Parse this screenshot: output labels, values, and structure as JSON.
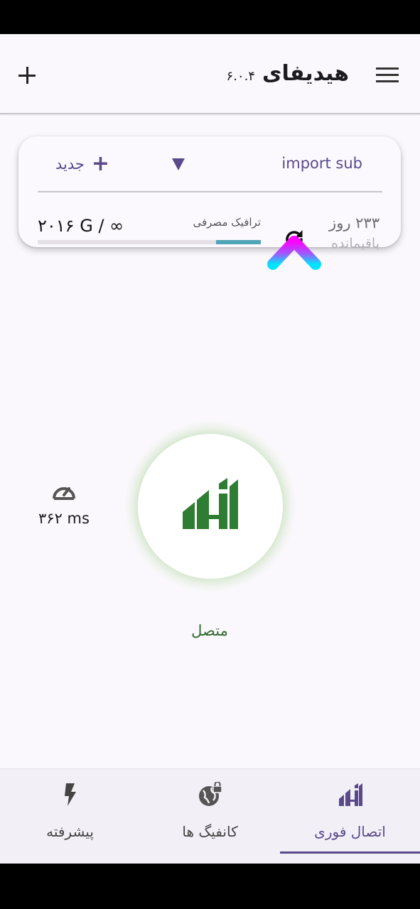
{
  "app_bar": {
    "title": "هیدیفای",
    "version": "۶.۰.۴",
    "add_icon": "plus-icon",
    "menu_icon": "hamburger-menu-icon"
  },
  "profile_card": {
    "new_label": "جدید",
    "import_sub_label": "import sub",
    "traffic_label": "ترافیک مصرفی",
    "traffic_value": "۲۰۱۶ G / ∞",
    "traffic_progress": 0.2,
    "days_left": "۲۳۳ روز",
    "remaining_label": "باقیمانده",
    "refresh_icon": "refresh-icon"
  },
  "connection": {
    "status": "متصل",
    "ping": "۳۶۲ ms",
    "ping_icon": "speedometer-icon",
    "button_icon": "hiddify-logo-icon"
  },
  "bottom_nav": {
    "items": [
      {
        "label": "پیشرفته",
        "icon": "bolt-icon",
        "active": false
      },
      {
        "label": "کانفیگ ها",
        "icon": "globe-lock-icon",
        "active": false
      },
      {
        "label": "اتصال فوری",
        "icon": "hiddify-logo-icon",
        "active": true
      }
    ]
  },
  "colors": {
    "accent": "#5a4a8a",
    "connected_green": "#2e7d32",
    "traffic_fill": "#4fa4b6",
    "annotation_arrow_top": "#ff00ff",
    "annotation_arrow_bottom": "#00e5ff"
  }
}
